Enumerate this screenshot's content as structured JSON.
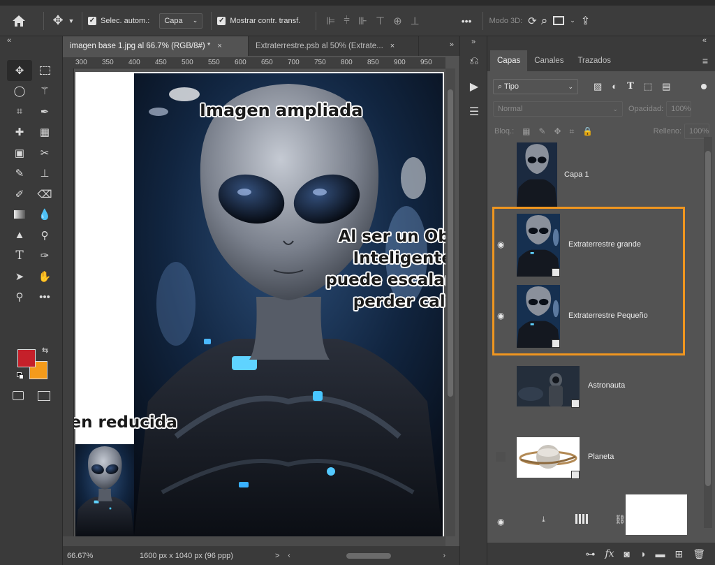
{
  "options_bar": {
    "auto_select_label": "Selec. autom.:",
    "auto_select_value": "Capa",
    "show_transform_label": "Mostrar contr. transf.",
    "more": "•••",
    "mode3d_label": "Modo 3D:"
  },
  "tabs": [
    {
      "label": "imagen base 1.jpg al 66.7% (RGB/8#) *",
      "close": "×"
    },
    {
      "label": "Extraterrestre.psb al 50% (Extrate...",
      "close": "×"
    }
  ],
  "ruler": [
    "300",
    "350",
    "400",
    "450",
    "500",
    "550",
    "600",
    "650",
    "700",
    "750",
    "800",
    "850",
    "900",
    "950"
  ],
  "canvas": {
    "title_big": "Imagen ampliada",
    "title_small": "Imagen reducida",
    "callout": [
      "Al ser un Objeto",
      "Inteligente, se",
      "puede escalar sin",
      "perder calidad"
    ]
  },
  "status": {
    "zoom": "66.67%",
    "doc_size": "1600 px x 1040 px (96 ppp)",
    "arrow": ">"
  },
  "layers_panel": {
    "tabs": [
      "Capas",
      "Canales",
      "Trazados"
    ],
    "filter_value": "Tipo",
    "blend_mode": "Normal",
    "opacity_label": "Opacidad:",
    "opacity_value": "100%",
    "lock_label": "Bloq.:",
    "fill_label": "Relleno:",
    "fill_value": "100%",
    "layers": [
      {
        "name": "Capa 1",
        "visible": false
      },
      {
        "name": "Extraterrestre grande",
        "visible": true
      },
      {
        "name": "Extraterrestre Pequeño",
        "visible": true
      },
      {
        "name": "Astronauta",
        "visible": false
      },
      {
        "name": "Planeta",
        "visible": false
      }
    ]
  },
  "colors": {
    "foreground": "#c5202a",
    "background": "#f49b1b",
    "highlight": "#f0961f"
  }
}
